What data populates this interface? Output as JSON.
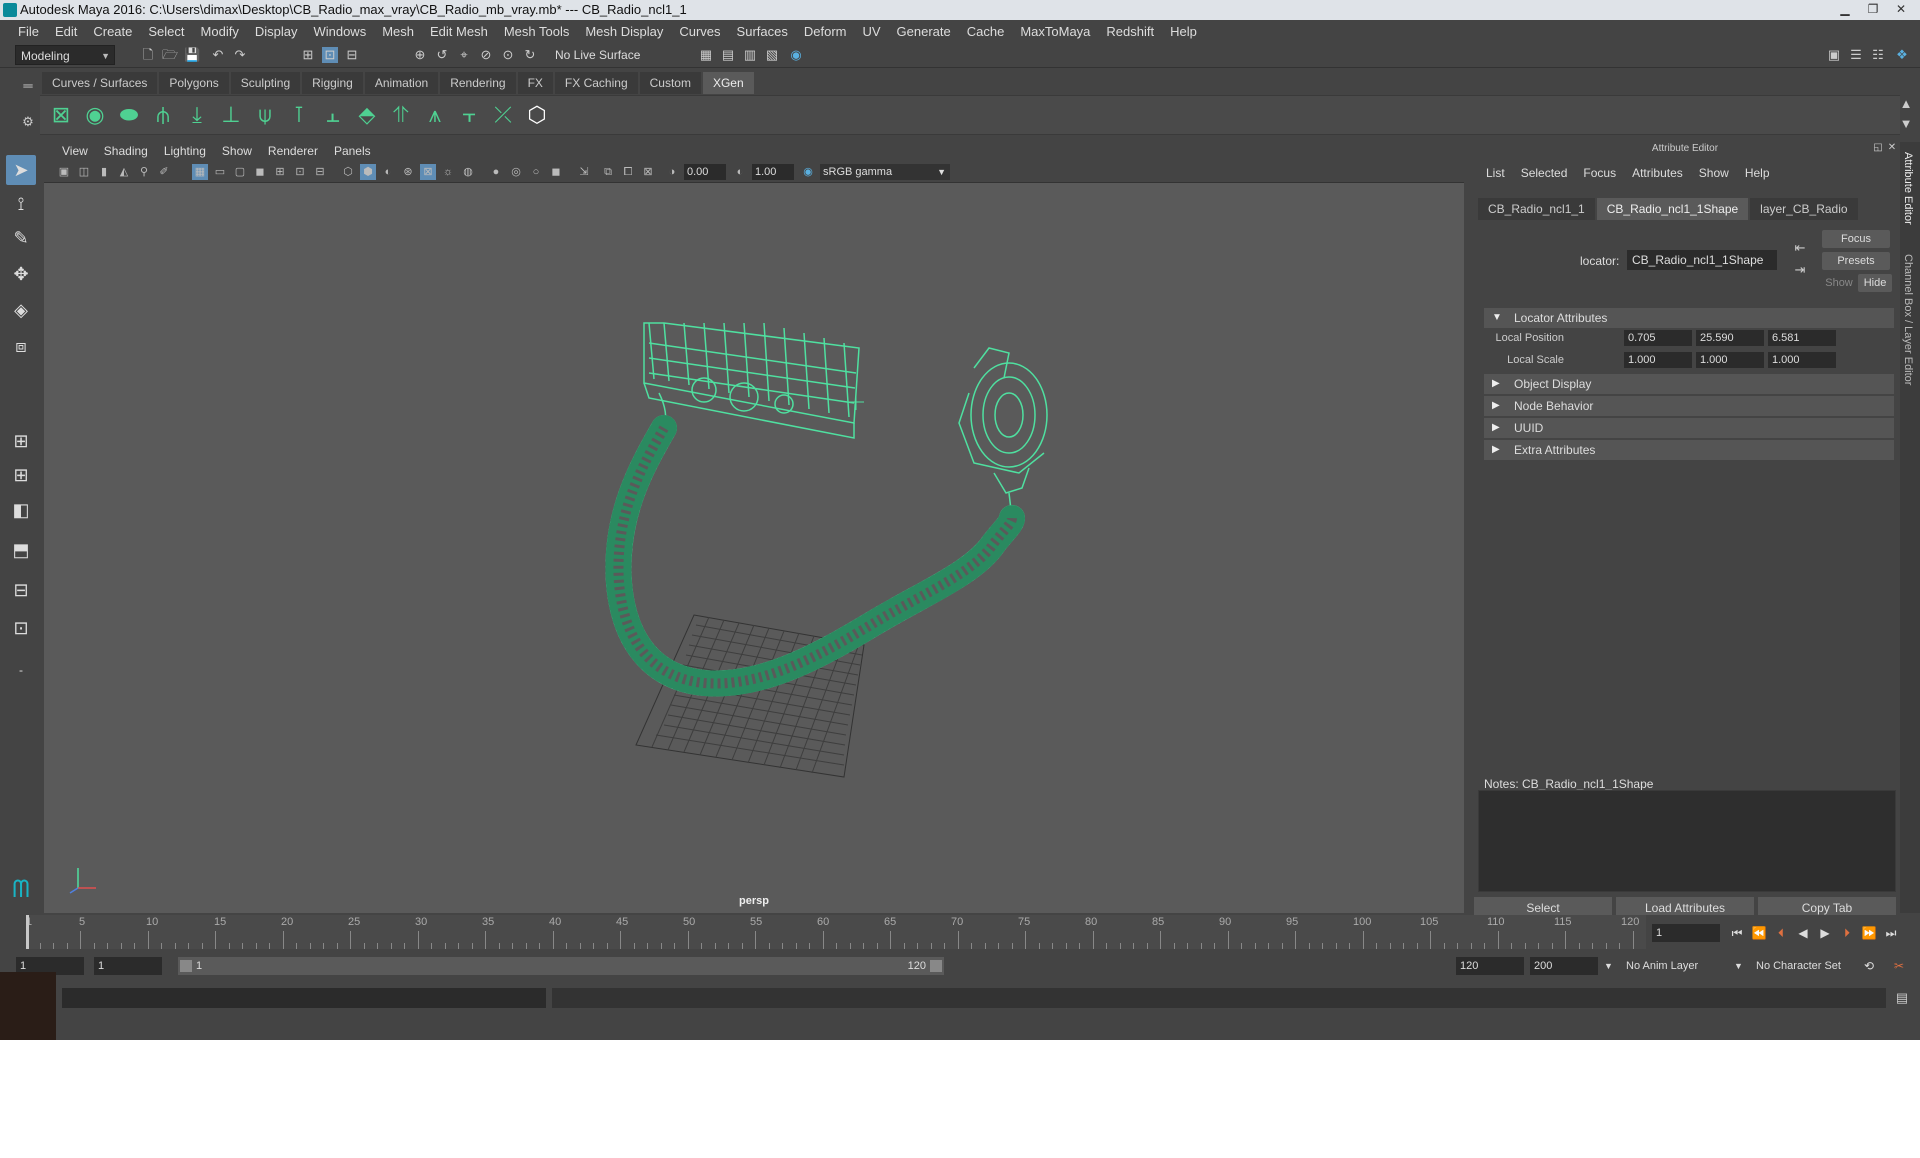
{
  "window": {
    "title": "Autodesk Maya 2016: C:\\Users\\dimax\\Desktop\\CB_Radio_max_vray\\CB_Radio_mb_vray.mb*   ---   CB_Radio_ncl1_1"
  },
  "menubar": [
    "File",
    "Edit",
    "Create",
    "Select",
    "Modify",
    "Display",
    "Windows",
    "Mesh",
    "Edit Mesh",
    "Mesh Tools",
    "Mesh Display",
    "Curves",
    "Surfaces",
    "Deform",
    "UV",
    "Generate",
    "Cache",
    "MaxToMaya",
    "Redshift",
    "Help"
  ],
  "statusline": {
    "mode": "Modeling",
    "live_surface": "No Live Surface"
  },
  "shelf": {
    "tabs": [
      "Curves / Surfaces",
      "Polygons",
      "Sculpting",
      "Rigging",
      "Animation",
      "Rendering",
      "FX",
      "FX Caching",
      "Custom",
      "XGen"
    ],
    "active_tab": "XGen"
  },
  "viewport": {
    "menu": [
      "View",
      "Shading",
      "Lighting",
      "Show",
      "Renderer",
      "Panels"
    ],
    "exposure": "0.00",
    "gamma": "1.00",
    "color_space": "sRGB gamma",
    "camera": "persp",
    "wire_color": "#4fe0a0"
  },
  "attribute_editor": {
    "title": "Attribute Editor",
    "menu": [
      "List",
      "Selected",
      "Focus",
      "Attributes",
      "Show",
      "Help"
    ],
    "tabs": [
      "CB_Radio_ncl1_1",
      "CB_Radio_ncl1_1Shape",
      "layer_CB_Radio"
    ],
    "active_tab": "CB_Radio_ncl1_1Shape",
    "buttons": {
      "focus": "Focus",
      "presets": "Presets",
      "show": "Show",
      "hide": "Hide"
    },
    "locator_label": "locator:",
    "locator_value": "CB_Radio_ncl1_1Shape",
    "sections": {
      "locator": "Locator Attributes",
      "object_display": "Object Display",
      "node_behavior": "Node Behavior",
      "uuid": "UUID",
      "extra": "Extra Attributes"
    },
    "local_position": {
      "label": "Local Position",
      "x": "0.705",
      "y": "25.590",
      "z": "6.581"
    },
    "local_scale": {
      "label": "Local Scale",
      "x": "1.000",
      "y": "1.000",
      "z": "1.000"
    },
    "notes_label": "Notes:  CB_Radio_ncl1_1Shape",
    "bottom_buttons": {
      "select": "Select",
      "load": "Load Attributes",
      "copy": "Copy Tab"
    }
  },
  "side_tabs": {
    "attribute_editor": "Attribute Editor",
    "channel_box": "Channel Box / Layer Editor"
  },
  "timeline": {
    "ticks": [
      "1",
      "5",
      "10",
      "15",
      "20",
      "25",
      "30",
      "35",
      "40",
      "45",
      "50",
      "55",
      "60",
      "65",
      "70",
      "75",
      "80",
      "85",
      "90",
      "95",
      "100",
      "105",
      "110",
      "115",
      "120"
    ],
    "current_frame": "1"
  },
  "range": {
    "start": "1",
    "playback_start": "1",
    "slider_start": "1",
    "slider_end": "120",
    "playback_end": "120",
    "end": "200",
    "anim_layer": "No Anim Layer",
    "character_set": "No Character Set"
  }
}
